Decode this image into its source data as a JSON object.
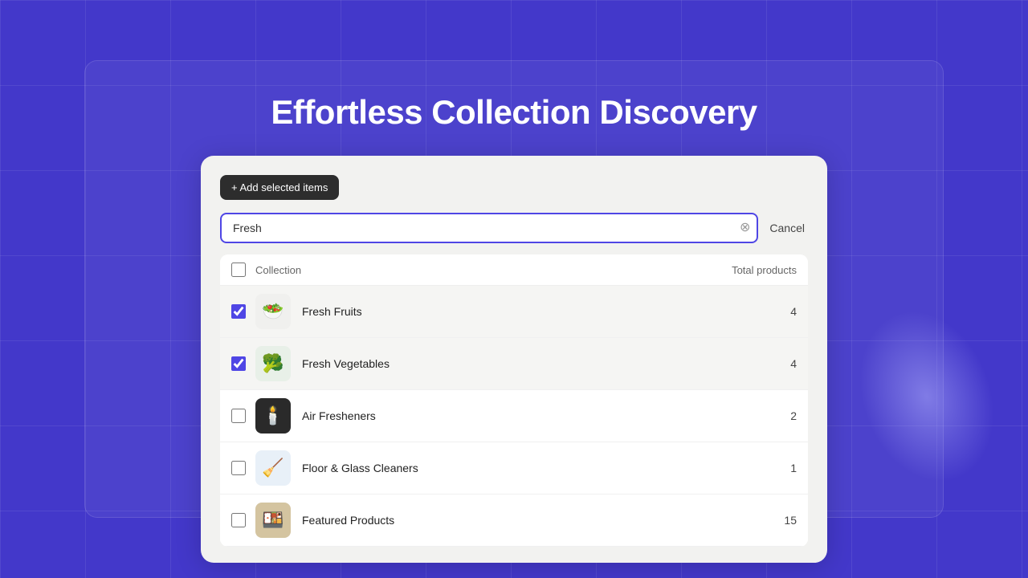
{
  "background_color": "#4338ca",
  "title": "Effortless Collection Discovery",
  "card": {
    "add_button_label": "+ Add selected items",
    "search_placeholder": "Fresh",
    "search_value": "Fresh",
    "cancel_label": "Cancel",
    "table": {
      "header_collection": "Collection",
      "header_total": "Total products",
      "rows": [
        {
          "id": 1,
          "name": "Fresh Fruits",
          "count": 4,
          "checked": true,
          "emoji": "🥗",
          "thumb_class": "thumb-fresh-fruits"
        },
        {
          "id": 2,
          "name": "Fresh Vegetables",
          "count": 4,
          "checked": true,
          "emoji": "🥦",
          "thumb_class": "thumb-fresh-vegetables"
        },
        {
          "id": 3,
          "name": "Air Fresheners",
          "count": 2,
          "checked": false,
          "emoji": "🕯️",
          "thumb_class": "thumb-air-fresheners"
        },
        {
          "id": 4,
          "name": "Floor & Glass Cleaners",
          "count": 1,
          "checked": false,
          "emoji": "🧹",
          "thumb_class": "thumb-floor-cleaners"
        },
        {
          "id": 5,
          "name": "Featured Products",
          "count": 15,
          "checked": false,
          "emoji": "🍱",
          "thumb_class": "thumb-featured"
        }
      ]
    }
  }
}
